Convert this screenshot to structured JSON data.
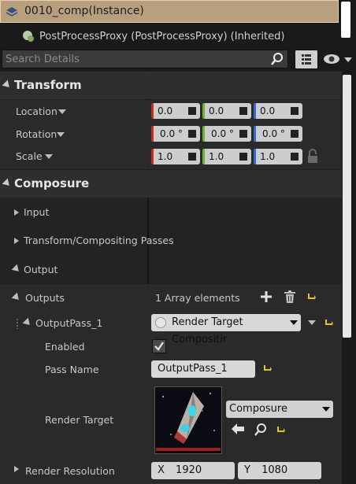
{
  "header": {
    "title": "0010_comp(Instance)",
    "component": "PostProcessProxy (PostProcessProxy) (Inherited)"
  },
  "search": {
    "placeholder": "Search Details",
    "value": ""
  },
  "transform": {
    "title": "Transform",
    "location": {
      "label": "Location",
      "x": "0.0",
      "y": "0.0",
      "z": "0.0"
    },
    "rotation": {
      "label": "Rotation",
      "x": "0.0 °",
      "y": "0.0 °",
      "z": "0.0 °"
    },
    "scale": {
      "label": "Scale",
      "x": "1.0",
      "y": "1.0",
      "z": "1.0"
    }
  },
  "composure": {
    "title": "Composure",
    "input_label": "Input",
    "passes_label": "Transform/Compositing Passes",
    "output_label": "Output",
    "outputs_label": "Outputs",
    "array_count": "1 Array elements",
    "output_pass_label": "OutputPass_1",
    "output_pass_type": "Render Target Compositir",
    "enabled_label": "Enabled",
    "enabled": true,
    "pass_name_label": "Pass Name",
    "pass_name_value": "OutputPass_1",
    "render_target_label": "Render Target",
    "render_target_value": "Composure",
    "render_resolution_label": "Render Resolution",
    "res_x_label": "X",
    "res_x": "1920",
    "res_y_label": "Y",
    "res_y": "1080"
  },
  "colors": {
    "x_axis": "#c62b1f",
    "y_axis": "#6fb523",
    "z_axis": "#2f6ed0",
    "reset_yellow": "#e6c21a",
    "title_bg": "#b8a07e"
  }
}
